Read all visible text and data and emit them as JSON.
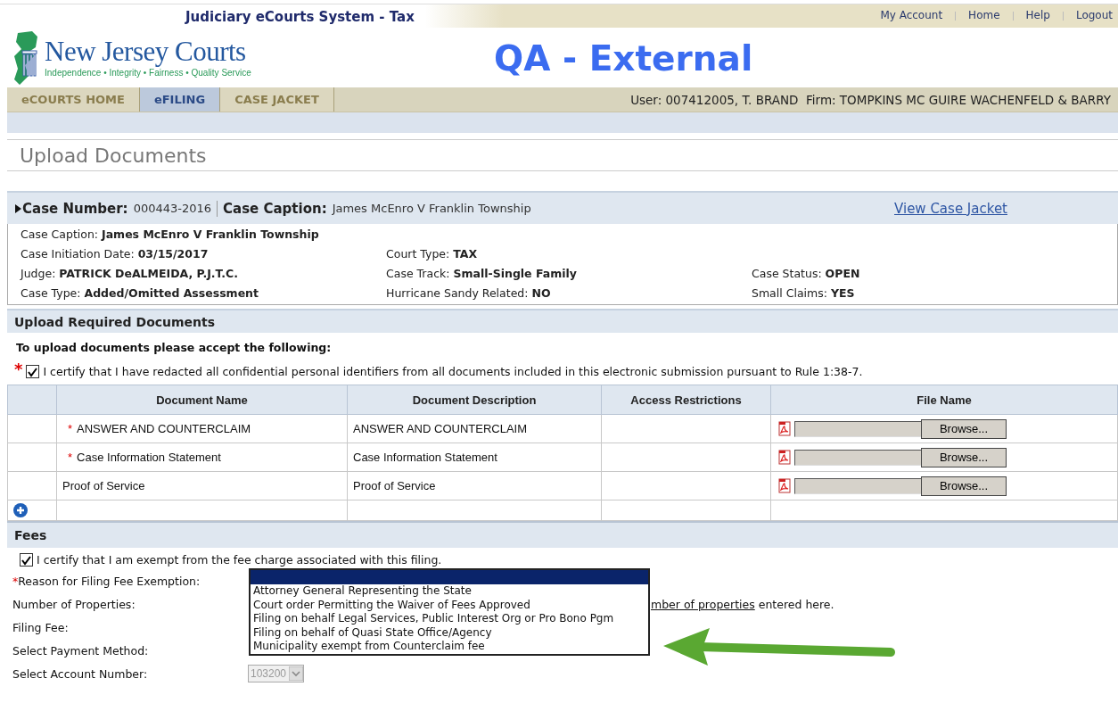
{
  "header": {
    "system_title": "Judiciary eCourts System - Tax",
    "links": [
      "My Account",
      "Home",
      "Help",
      "Logout"
    ],
    "logo_title": "New Jersey Courts",
    "logo_tagline": "Independence • Integrity • Fairness • Quality Service",
    "environment": "QA - External",
    "tabs": [
      {
        "label": "eCOURTS HOME",
        "selected": false
      },
      {
        "label": "eFILING",
        "selected": true
      },
      {
        "label": "CASE JACKET",
        "selected": false
      }
    ],
    "user_info": "User: 007412005, T. BRAND  Firm: TOMPKINS MC GUIRE WACHENFELD & BARRY"
  },
  "page_title": "Upload Documents",
  "case_bar": {
    "fields": [
      {
        "label": "Case Number:",
        "value": "000443-2016"
      },
      {
        "label": "Case Caption:",
        "value": "James McEnro V Franklin Township"
      }
    ],
    "link": "View Case Jacket"
  },
  "case_details": [
    [
      {
        "label": "Case Caption:",
        "value": "James McEnro V Franklin Township"
      }
    ],
    [
      {
        "label": "Case Initiation Date:",
        "value": "03/15/2017"
      },
      {
        "label": "Court Type:",
        "value": "TAX"
      }
    ],
    [
      {
        "label": "Judge:",
        "value": "PATRICK DeALMEIDA, P.J.T.C."
      },
      {
        "label": "Case Track:",
        "value": "Small-Single Family"
      },
      {
        "label": "Case Status:",
        "value": "OPEN"
      }
    ],
    [
      {
        "label": "Case Type:",
        "value": "Added/Omitted Assessment"
      },
      {
        "label": "Hurricane Sandy Related:",
        "value": "NO"
      },
      {
        "label": "Small Claims:",
        "value": "YES"
      }
    ]
  ],
  "upload": {
    "title": "Upload Required Documents",
    "instruction": "To upload documents please accept the following:",
    "certify": {
      "marker": "*",
      "checked": true,
      "text": "I certify that I have redacted all confidential personal identifiers from all documents included in this electronic submission pursuant to Rule 1:38-7."
    },
    "columns": [
      "Document Name",
      "Document Description",
      "Access Restrictions",
      "File Name"
    ],
    "rows": [
      {
        "marker": "*",
        "name": "ANSWER AND COUNTERCLAIM",
        "description": "ANSWER AND COUNTERCLAIM",
        "browse": "Browse..."
      },
      {
        "marker": "*",
        "name": "Case Information Statement",
        "description": "Case Information Statement",
        "browse": "Browse..."
      },
      {
        "name": "Proof of Service",
        "description": "Proof of Service",
        "browse": "Browse..."
      }
    ]
  },
  "fees": {
    "title": "Fees",
    "exempt": {
      "checked": true,
      "text": "I certify that I am exempt from the fee charge associated with this filing."
    },
    "fields": [
      {
        "kind": "dropdown",
        "marker": "*",
        "label": "Reason for Filing Fee Exemption:",
        "options": [
          "Attorney General Representing the State",
          "Court order Permitting the Waiver of Fees Approved",
          "Filing on behalf Legal Services, Public Interest Org or Pro Bono Pgm",
          "Filing on behalf of Quasi State Office/Agency",
          "Municipality exempt from Counterclaim fee"
        ]
      },
      {
        "kind": "note",
        "label": "Number of Properties:",
        "link": "mber of properties",
        "note": " entered here."
      },
      {
        "kind": "plain",
        "label": "Filing Fee:"
      },
      {
        "kind": "plain",
        "label": "Select Payment Method:"
      },
      {
        "kind": "select",
        "label": "Select Account Number:",
        "value": "103200",
        "disabled": true
      }
    ]
  }
}
